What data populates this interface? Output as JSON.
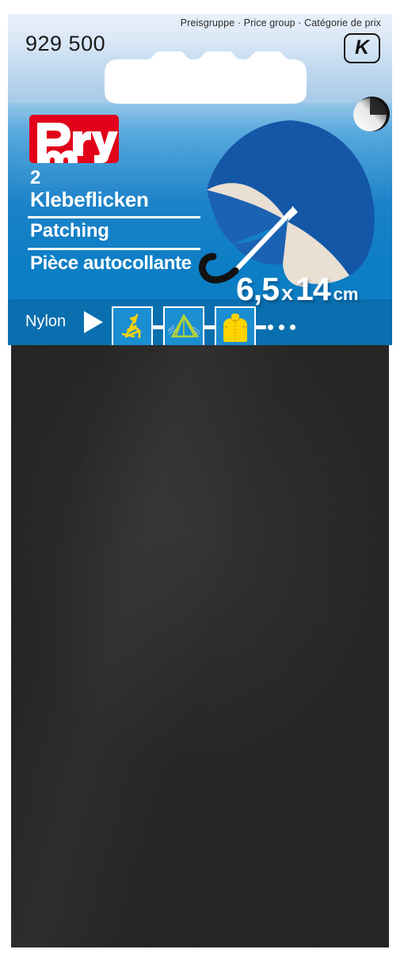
{
  "product": {
    "article_number": "929 500",
    "price_group_label": "Preisgruppe · Price group · Catégorie de prix",
    "price_group_value": "K",
    "brand": "Prym",
    "quantity": "2",
    "name_de": "Klebeflicken",
    "name_en": "Patching",
    "name_fr": "Pièce autocollante",
    "size_value": "6,5",
    "size_separator": "x",
    "size_value2": "14",
    "size_unit": "cm",
    "material": "Nylon"
  },
  "applications": [
    {
      "name": "deck-chair",
      "label": "deck chair"
    },
    {
      "name": "tent",
      "label": "tent"
    },
    {
      "name": "rain-jacket",
      "label": "rain jacket"
    }
  ],
  "colors": {
    "brand_red": "#e2001a",
    "panel_blue": "#0d7ec5",
    "strip_blue": "#0a6fae",
    "icon_blue": "#1b8ed1",
    "fabric_black": "#262524",
    "umbrella_blue": "#1a5fab",
    "umbrella_cream": "#e7ddd1",
    "icon_yellow": "#ffd400",
    "icon_green": "#b5d334"
  }
}
